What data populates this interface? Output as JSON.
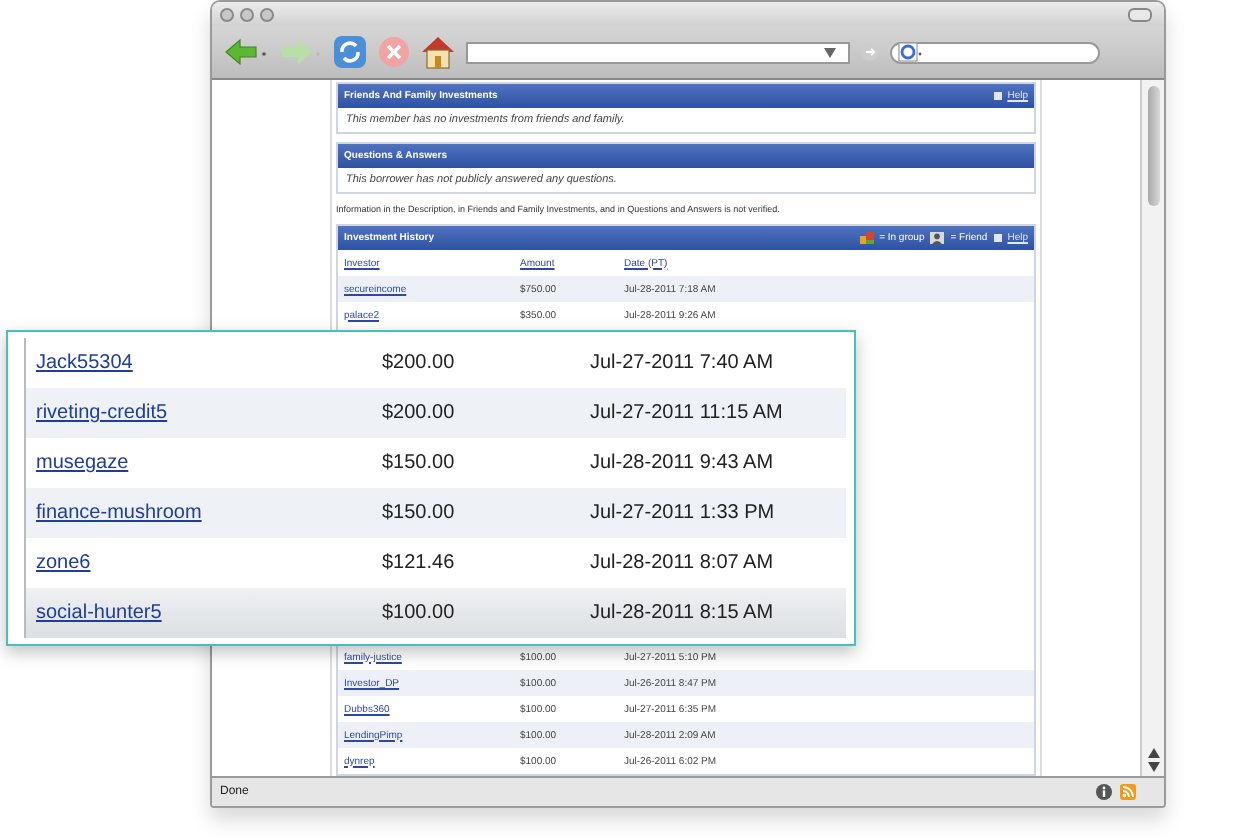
{
  "sections": [
    {
      "title": "Friends And Family Investments",
      "help": "Help",
      "body": "This member has no investments from friends and family."
    },
    {
      "title": "Questions & Answers",
      "body": "This borrower has not publicly answered any questions."
    }
  ],
  "disclaimer": "Information in the Description, in Friends and Family Investments, and in Questions and Answers is not verified.",
  "investment_history": {
    "title": "Investment History",
    "legend": [
      {
        "kind": "group",
        "label": "= In group"
      },
      {
        "kind": "friend",
        "label": "= Friend"
      }
    ],
    "help": "Help",
    "columns": [
      "Investor",
      "Amount",
      "Date (PT)"
    ],
    "rows_top": [
      {
        "investor": "secureincome",
        "amount": "$750.00",
        "date": "Jul-28-2011 7:18 AM"
      },
      {
        "investor": "palace2",
        "amount": "$350.00",
        "date": "Jul-28-2011 9:26 AM"
      }
    ],
    "rows_bottom": [
      {
        "investor": "family-justice",
        "amount": "$100.00",
        "date": "Jul-27-2011 5:10 PM"
      },
      {
        "investor": "Investor_DP",
        "amount": "$100.00",
        "date": "Jul-26-2011 8:47 PM"
      },
      {
        "investor": "Dubbs360",
        "amount": "$100.00",
        "date": "Jul-27-2011 6:35 PM"
      },
      {
        "investor": "LendingPimp",
        "amount": "$100.00",
        "date": "Jul-28-2011 2:09 AM"
      },
      {
        "investor": "dynrep",
        "amount": "$100.00",
        "date": "Jul-26-2011 6:02 PM"
      }
    ]
  },
  "callout": {
    "rows": [
      {
        "investor": "Jack55304",
        "amount": "$200.00",
        "date": "Jul-27-2011 7:40 AM"
      },
      {
        "investor": "riveting-credit5",
        "amount": "$200.00",
        "date": "Jul-27-2011 11:15 AM"
      },
      {
        "investor": "musegaze",
        "amount": "$150.00",
        "date": "Jul-28-2011 9:43 AM"
      },
      {
        "investor": "finance-mushroom",
        "amount": "$150.00",
        "date": "Jul-27-2011 1:33 PM"
      },
      {
        "investor": "zone6",
        "amount": "$121.46",
        "date": "Jul-28-2011 8:07 AM"
      },
      {
        "investor": "social-hunter5",
        "amount": "$100.00",
        "date": "Jul-28-2011 8:15 AM"
      }
    ]
  },
  "status_bar": {
    "text": "Done"
  }
}
